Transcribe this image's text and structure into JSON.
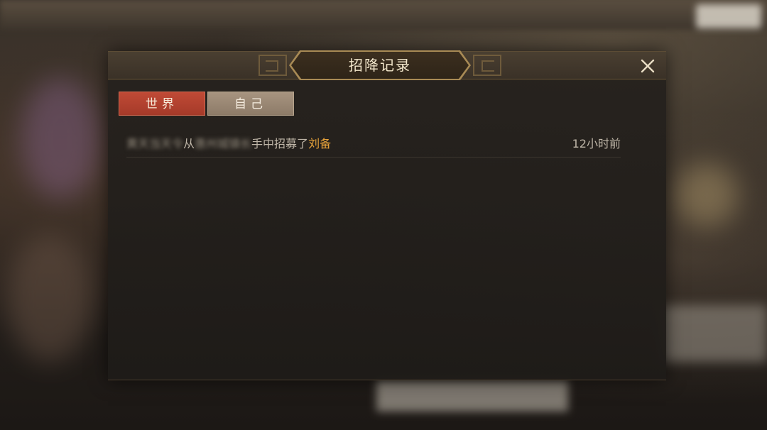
{
  "dialog": {
    "title": "招降记录",
    "close_icon": "close-icon"
  },
  "tabs": [
    {
      "label": "世界",
      "active": true
    },
    {
      "label": "自己",
      "active": false
    }
  ],
  "records": [
    {
      "player_obscured": "黄天当天令",
      "text_from": "从",
      "owner_obscured": "惠州城镇长",
      "text_action": "手中招募了",
      "hero": "刘备",
      "time": "12小时前"
    }
  ],
  "colors": {
    "active_tab": "#c04a36",
    "inactive_tab": "#a79480",
    "hero_highlight": "#e6a23a",
    "title_text": "#f3e7cc"
  }
}
